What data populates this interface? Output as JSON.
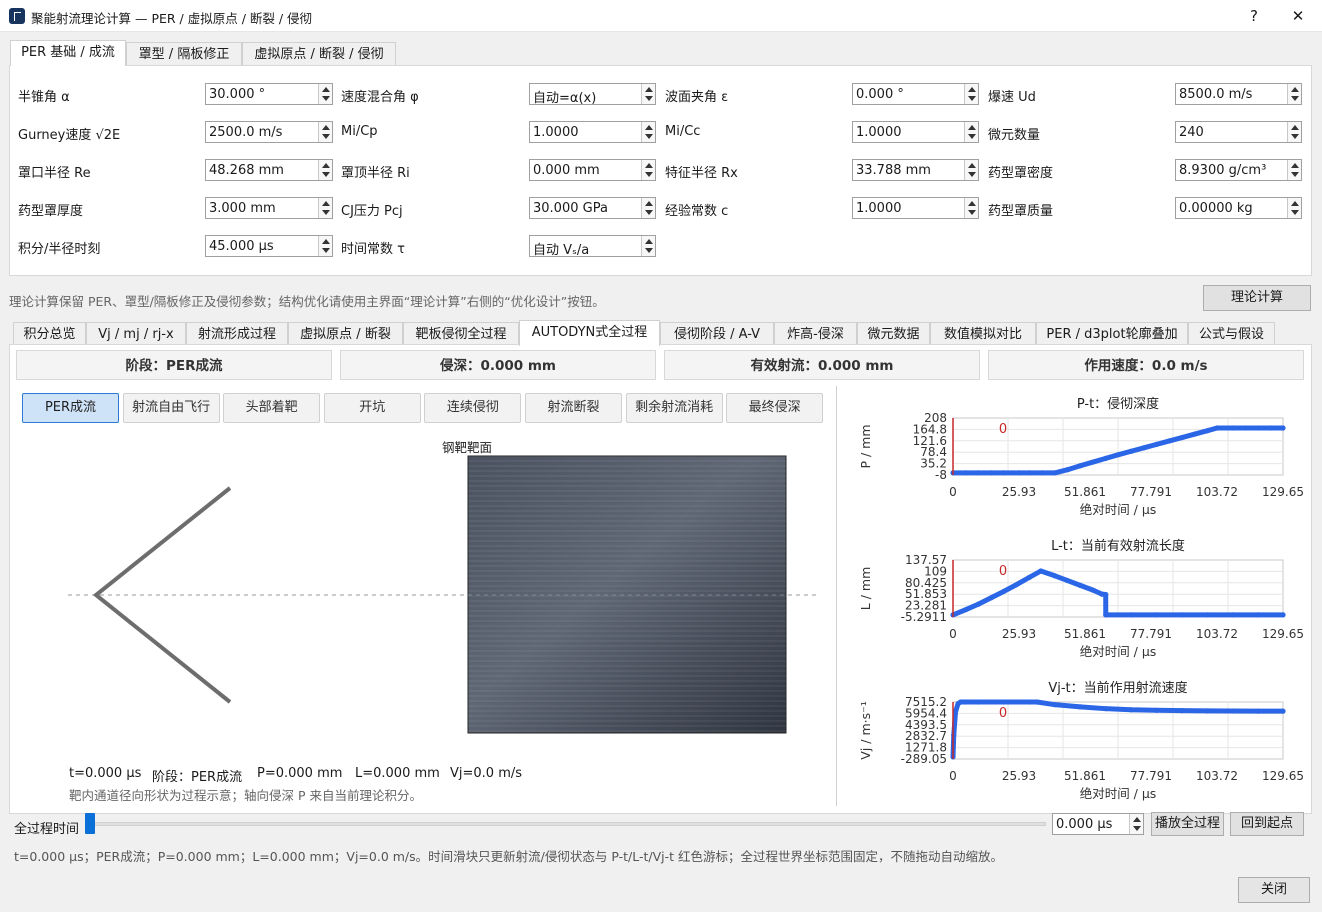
{
  "window": {
    "title": "聚能射流理论计算 — PER / 虚拟原点 / 断裂 / 侵彻",
    "help": "?",
    "close": "✕"
  },
  "top_tabs": [
    "PER 基础 / 成流",
    "罩型 / 隔板修正",
    "虚拟原点 / 断裂 / 侵彻"
  ],
  "params": [
    [
      {
        "label": "半锥角 α",
        "value": "30.000 °"
      },
      {
        "label": "速度混合角 φ",
        "value": "自动=α(x)"
      },
      {
        "label": "波面夹角 ε",
        "value": "0.000 °"
      },
      {
        "label": "爆速 Ud",
        "value": "8500.0 m/s"
      }
    ],
    [
      {
        "label": "Gurney速度 √2E",
        "value": "2500.0 m/s"
      },
      {
        "label": "Mi/Cp",
        "value": "1.0000"
      },
      {
        "label": "Mi/Cc",
        "value": "1.0000"
      },
      {
        "label": "微元数量",
        "value": "240"
      }
    ],
    [
      {
        "label": "罩口半径 Re",
        "value": "48.268 mm"
      },
      {
        "label": "罩顶半径 Ri",
        "value": "0.000 mm"
      },
      {
        "label": "特征半径 Rx",
        "value": "33.788 mm"
      },
      {
        "label": "药型罩密度",
        "value": "8.9300 g/cm³"
      }
    ],
    [
      {
        "label": "药型罩厚度",
        "value": "3.000 mm"
      },
      {
        "label": "CJ压力 Pcj",
        "value": "30.000 GPa"
      },
      {
        "label": "经验常数 c",
        "value": "1.0000"
      },
      {
        "label": "药型罩质量",
        "value": "0.00000 kg"
      }
    ],
    [
      {
        "label": "积分/半径时刻",
        "value": "45.000 μs"
      },
      {
        "label": "时间常数 τ",
        "value": "自动 Vₛ/a"
      }
    ]
  ],
  "hint": "理论计算保留 PER、罩型/隔板修正及侵彻参数；结构优化请使用主界面“理论计算”右侧的“优化设计”按钮。",
  "calc_button": "理论计算",
  "result_tabs": [
    "积分总览",
    "Vj / mj / rj-x",
    "射流形成过程",
    "虚拟原点 / 断裂",
    "靶板侵彻全过程",
    "AUTODYN式全过程",
    "侵彻阶段 / A-V",
    "炸高-侵深",
    "微元数据",
    "数值模拟对比",
    "PER / d3plot轮廓叠加",
    "公式与假设"
  ],
  "stats": [
    "阶段：PER成流",
    "侵深：0.000 mm",
    "有效射流：0.000 mm",
    "作用速度：0.0 m/s"
  ],
  "phases": [
    "PER成流",
    "射流自由飞行",
    "头部着靶",
    "开坑",
    "连续侵彻",
    "射流断裂",
    "剩余射流消耗",
    "最终侵深"
  ],
  "target_label": "钢靶靶面",
  "readout": [
    "t=0.000 μs",
    "阶段：PER成流",
    "P=0.000 mm",
    "L=0.000 mm",
    "Vj=0.0 m/s"
  ],
  "readout_note": "靶内通道径向形状为过程示意；轴向侵深 P 来自当前理论积分。",
  "slider": {
    "label": "全过程时间",
    "value": "0.000 μs",
    "play": "播放全过程",
    "reset": "回到起点",
    "position": 0
  },
  "status": "t=0.000 μs；PER成流；P=0.000 mm；L=0.000 mm；Vj=0.0 m/s。时间滑块只更新射流/侵彻状态与 P-t/L-t/Vj-t 红色游标；全过程世界坐标范围固定，不随拖动自动缩放。",
  "close_button": "关闭",
  "colors": {
    "accent": "#2b66e6",
    "cursor": "#c62828"
  },
  "chart_data": [
    {
      "type": "line",
      "title": "P-t：侵彻深度",
      "xlabel": "绝对时间 / μs",
      "ylabel": "P / mm",
      "xticks": [
        "0",
        "25.93",
        "51.861",
        "77.791",
        "103.72",
        "129.65"
      ],
      "yticks": [
        "208",
        "164.8",
        "121.6",
        "78.4",
        "35.2",
        "-8"
      ],
      "xlim": [
        0,
        129.65
      ],
      "ylim": [
        -8,
        208
      ],
      "cursor": {
        "x": 0,
        "label": "0"
      },
      "series": [
        {
          "x": [
            0,
            5,
            10,
            15,
            20,
            25.93,
            30,
            35,
            40,
            45,
            50,
            55,
            60,
            65,
            70,
            75,
            80,
            85,
            90,
            95,
            100,
            103.72,
            110,
            115,
            120,
            125,
            129.65
          ],
          "y": [
            0,
            0,
            0,
            0,
            0,
            0,
            0,
            0,
            0,
            12,
            27,
            41,
            55,
            69,
            82,
            95,
            108,
            121,
            134,
            147,
            160,
            170,
            170,
            170,
            170,
            170,
            170
          ]
        }
      ]
    },
    {
      "type": "line",
      "title": "L-t：当前有效射流长度",
      "xlabel": "绝对时间 / μs",
      "ylabel": "L / mm",
      "xticks": [
        "0",
        "25.93",
        "51.861",
        "77.791",
        "103.72",
        "129.65"
      ],
      "yticks": [
        "137.57",
        "109",
        "80.425",
        "51.853",
        "23.281",
        "-5.2911"
      ],
      "xlim": [
        0,
        129.65
      ],
      "ylim": [
        -5.2911,
        137.57
      ],
      "cursor": {
        "x": 0,
        "label": "0"
      },
      "series": [
        {
          "x": [
            0,
            5,
            10,
            15,
            20,
            25,
            30,
            34.5,
            40,
            45,
            50,
            55,
            58.5,
            60,
            60.01,
            70,
            80,
            90,
            100,
            110,
            120,
            129.65
          ],
          "y": [
            0,
            13,
            27,
            43,
            59,
            76,
            94,
            110,
            98,
            86,
            74,
            62,
            52,
            51,
            0,
            0,
            0,
            0,
            0,
            0,
            0,
            0
          ]
        }
      ]
    },
    {
      "type": "line",
      "title": "Vj-t：当前作用射流速度",
      "xlabel": "绝对时间 / μs",
      "ylabel": "Vj / m·s⁻¹",
      "xticks": [
        "0",
        "25.93",
        "51.861",
        "77.791",
        "103.72",
        "129.65"
      ],
      "yticks": [
        "7515.2",
        "5954.4",
        "4393.5",
        "2832.7",
        "1271.8",
        "-289.05"
      ],
      "xlim": [
        0,
        129.65
      ],
      "ylim": [
        -289.05,
        7515.2
      ],
      "cursor": {
        "x": 0,
        "label": "0"
      },
      "series": [
        {
          "x": [
            0,
            0.3,
            1,
            2,
            3,
            5,
            10,
            20,
            30,
            33,
            40,
            50,
            60,
            70,
            80,
            90,
            100,
            110,
            120,
            129.65
          ],
          "y": [
            0,
            3000,
            6200,
            7300,
            7515.2,
            7515.2,
            7515.2,
            7515.2,
            7515.2,
            7515.2,
            7150,
            6850,
            6600,
            6450,
            6380,
            6330,
            6300,
            6280,
            6270,
            6260
          ]
        }
      ]
    }
  ]
}
